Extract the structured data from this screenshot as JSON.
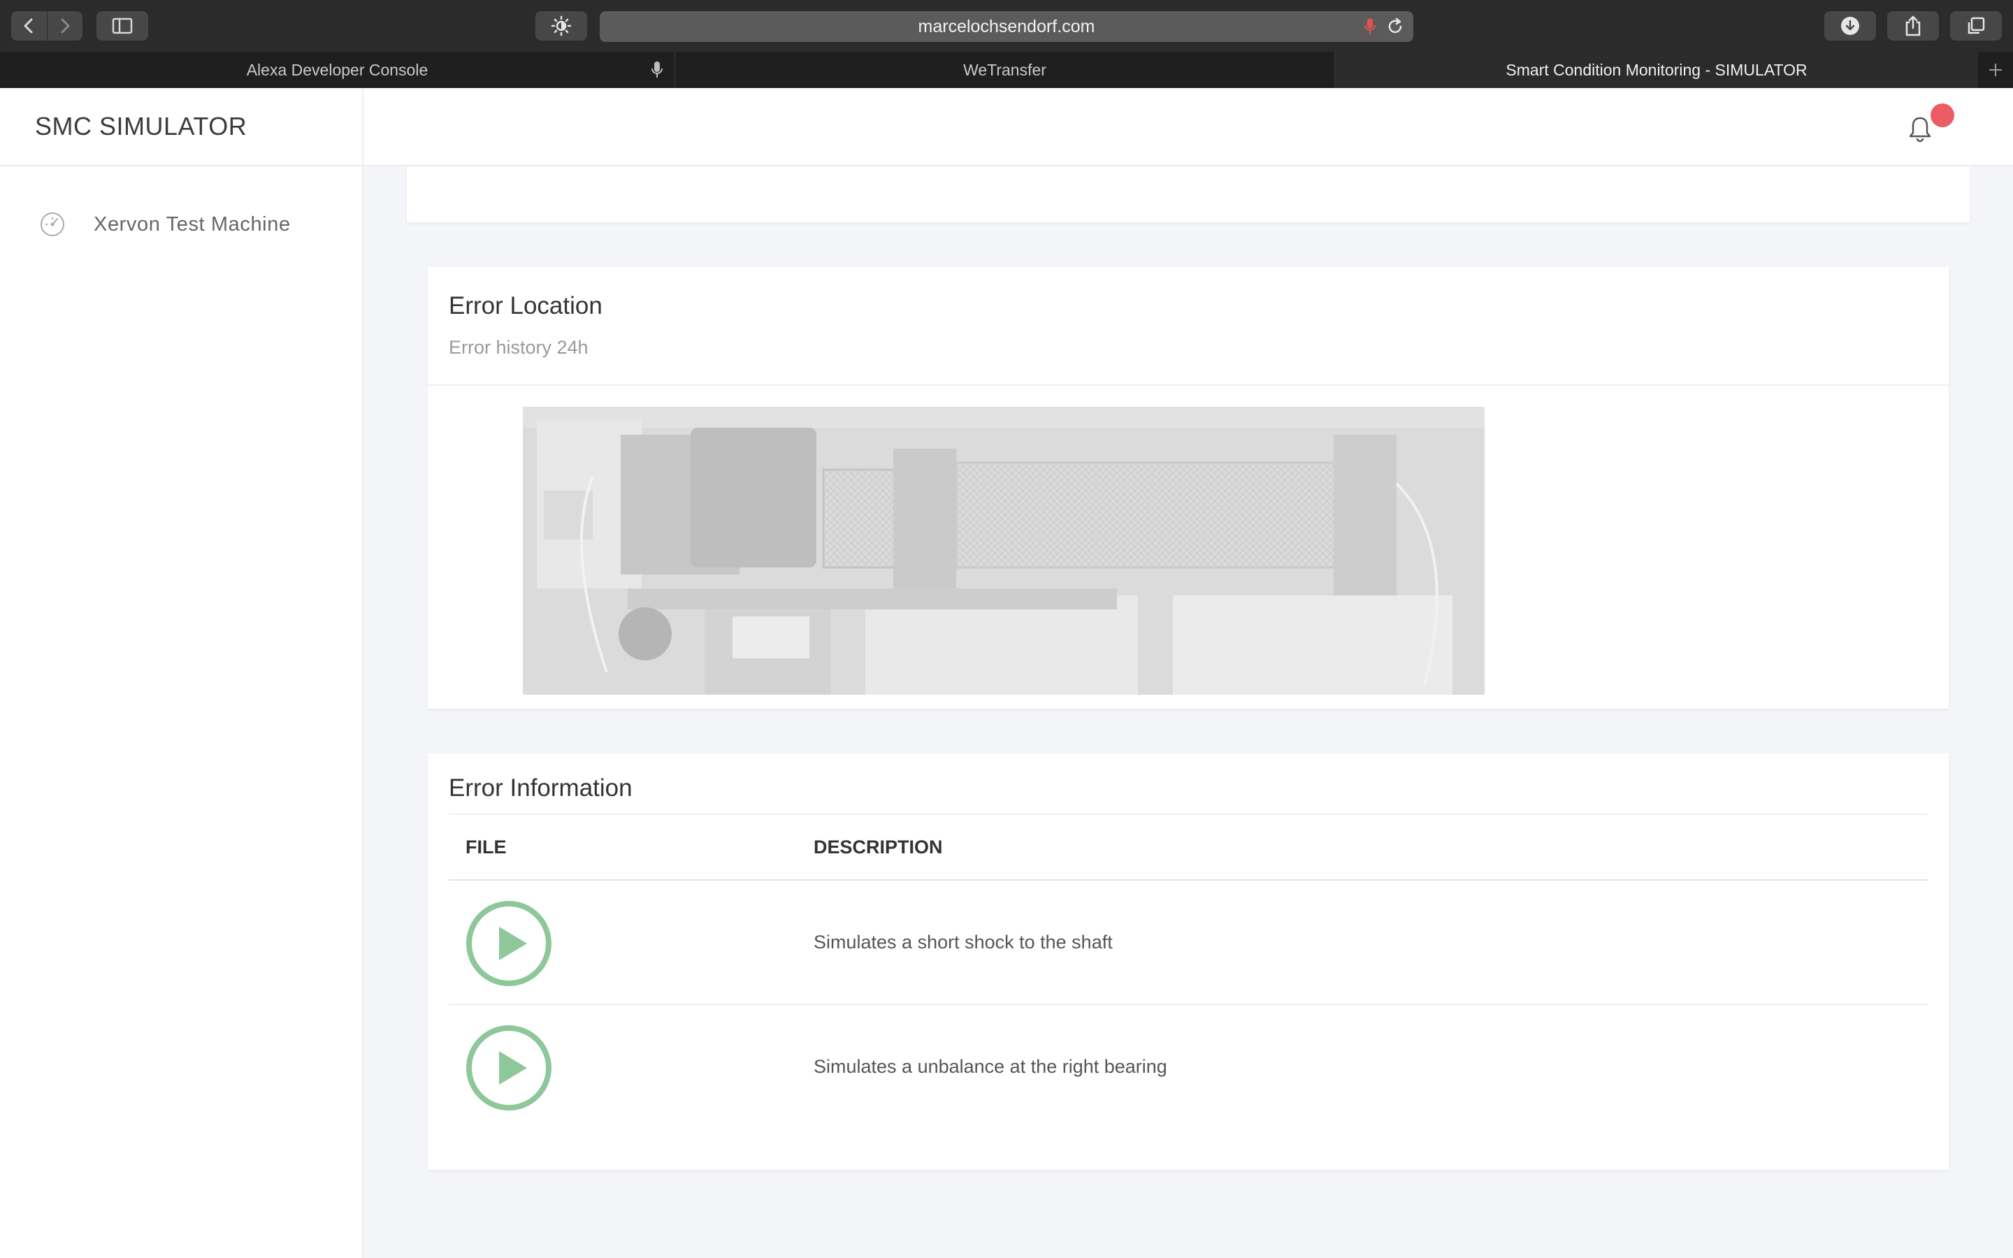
{
  "browser": {
    "url": "marcelochsendorf.com",
    "tabs": [
      {
        "label": "Alexa Developer Console"
      },
      {
        "label": "WeTransfer"
      },
      {
        "label": "Smart Condition Monitoring - SIMULATOR"
      }
    ]
  },
  "app": {
    "brand": "SMC SIMULATOR",
    "sidebar": {
      "items": [
        {
          "label": "Xervon Test Machine",
          "icon": "gauge-icon"
        }
      ]
    },
    "notifications": {
      "has_unread": true,
      "dot_color": "#eb5d63"
    }
  },
  "error_location": {
    "title": "Error Location",
    "subtitle": "Error history 24h",
    "image": "test-machine-photo"
  },
  "error_information": {
    "title": "Error Information",
    "columns": {
      "file": "FILE",
      "description": "DESCRIPTION"
    },
    "rows": [
      {
        "description": "Simulates a short shock to the shaft",
        "icon": "play-icon"
      },
      {
        "description": "Simulates a unbalance at the right bearing",
        "icon": "play-icon"
      }
    ],
    "accent_color": "#8ec79a"
  }
}
